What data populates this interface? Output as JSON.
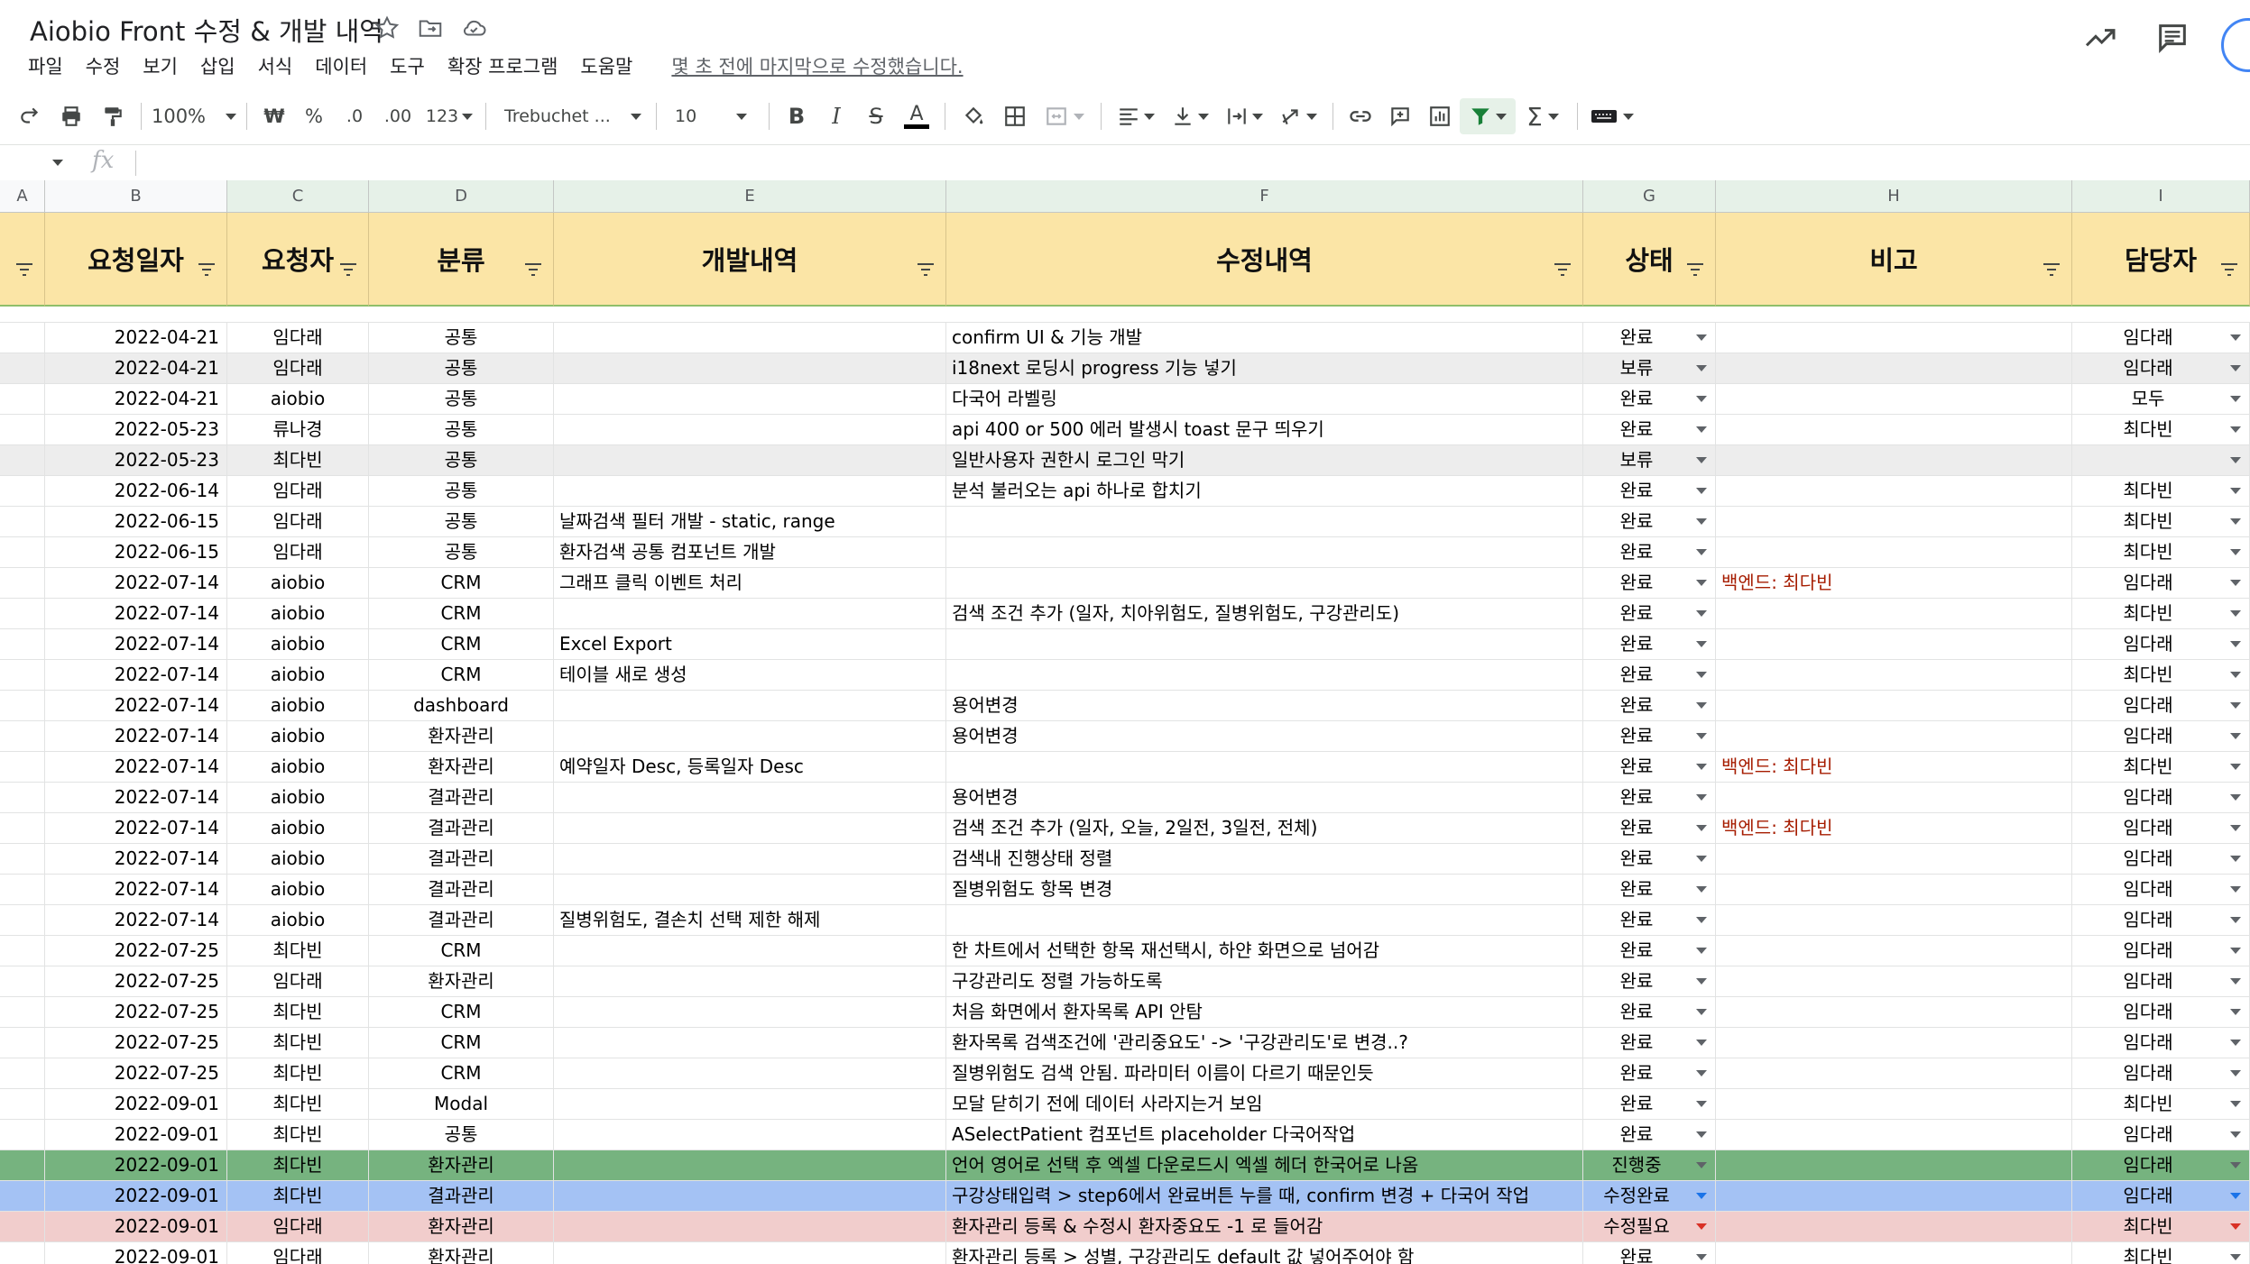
{
  "window": {
    "title": "Aiobio Front 수정 & 개발 내역",
    "menu": [
      "파일",
      "수정",
      "보기",
      "삽입",
      "서식",
      "데이터",
      "도구",
      "확장 프로그램",
      "도움말"
    ],
    "last_edit": "몇 초 전에 마지막으로 수정했습니다."
  },
  "toolbar": {
    "zoom": "100%",
    "currency": "₩",
    "percent": "%",
    "decimal_decrease": ".0",
    "decimal_increase": ".00",
    "number_format": "123",
    "font": "Trebuchet ...",
    "font_size": "10"
  },
  "formula_bar": {
    "fx": "fx",
    "value": ""
  },
  "sheet": {
    "column_letters": [
      "A",
      "B",
      "C",
      "D",
      "E",
      "F",
      "G",
      "H",
      "I"
    ],
    "header_row": [
      "",
      "요청일자",
      "요청자",
      "분류",
      "개발내역",
      "수정내역",
      "상태",
      "비고",
      "담당자"
    ],
    "rows": [
      {
        "date": "2022-04-21",
        "req": "임다래",
        "cat": "공통",
        "dev": "",
        "fix": "confirm UI & 기능 개발",
        "status": "완료",
        "note": "",
        "owner": "임다래",
        "style": "normal"
      },
      {
        "date": "2022-04-21",
        "req": "임다래",
        "cat": "공통",
        "dev": "",
        "fix": "i18next 로딩시 progress 기능 넣기",
        "status": "보류",
        "note": "",
        "owner": "임다래",
        "style": "gray"
      },
      {
        "date": "2022-04-21",
        "req": "aiobio",
        "cat": "공통",
        "dev": "",
        "fix": "다국어 라벨링",
        "status": "완료",
        "note": "",
        "owner": "모두",
        "style": "normal"
      },
      {
        "date": "2022-05-23",
        "req": "류나경",
        "cat": "공통",
        "dev": "",
        "fix": "api 400 or 500 에러 발생시 toast 문구 띄우기",
        "status": "완료",
        "note": "",
        "owner": "최다빈",
        "style": "normal"
      },
      {
        "date": "2022-05-23",
        "req": "최다빈",
        "cat": "공통",
        "dev": "",
        "fix": "일반사용자 권한시 로그인 막기",
        "status": "보류",
        "note": "",
        "owner": "",
        "style": "gray"
      },
      {
        "date": "2022-06-14",
        "req": "임다래",
        "cat": "공통",
        "dev": "",
        "fix": "분석 불러오는 api 하나로 합치기",
        "status": "완료",
        "note": "",
        "owner": "최다빈",
        "style": "normal"
      },
      {
        "date": "2022-06-15",
        "req": "임다래",
        "cat": "공통",
        "dev": "날짜검색 필터 개발 - static, range",
        "fix": "",
        "status": "완료",
        "note": "",
        "owner": "최다빈",
        "style": "normal"
      },
      {
        "date": "2022-06-15",
        "req": "임다래",
        "cat": "공통",
        "dev": "환자검색 공통 컴포넌트 개발",
        "fix": "",
        "status": "완료",
        "note": "",
        "owner": "최다빈",
        "style": "normal"
      },
      {
        "date": "2022-07-14",
        "req": "aiobio",
        "cat": "CRM",
        "dev": "그래프 클릭 이벤트 처리",
        "fix": "",
        "status": "완료",
        "note": "백엔드: 최다빈",
        "owner": "임다래",
        "style": "normal"
      },
      {
        "date": "2022-07-14",
        "req": "aiobio",
        "cat": "CRM",
        "dev": "",
        "fix": "검색 조건 추가 (일자, 치아위험도, 질병위험도, 구강관리도)",
        "status": "완료",
        "note": "",
        "owner": "최다빈",
        "style": "normal"
      },
      {
        "date": "2022-07-14",
        "req": "aiobio",
        "cat": "CRM",
        "dev": "Excel Export",
        "fix": "",
        "status": "완료",
        "note": "",
        "owner": "임다래",
        "style": "normal"
      },
      {
        "date": "2022-07-14",
        "req": "aiobio",
        "cat": "CRM",
        "dev": "테이블 새로 생성",
        "fix": "",
        "status": "완료",
        "note": "",
        "owner": "최다빈",
        "style": "normal"
      },
      {
        "date": "2022-07-14",
        "req": "aiobio",
        "cat": "dashboard",
        "dev": "",
        "fix": "용어변경",
        "status": "완료",
        "note": "",
        "owner": "임다래",
        "style": "normal"
      },
      {
        "date": "2022-07-14",
        "req": "aiobio",
        "cat": "환자관리",
        "dev": "",
        "fix": "용어변경",
        "status": "완료",
        "note": "",
        "owner": "임다래",
        "style": "normal"
      },
      {
        "date": "2022-07-14",
        "req": "aiobio",
        "cat": "환자관리",
        "dev": "예약일자 Desc, 등록일자 Desc",
        "fix": "",
        "status": "완료",
        "note": "백엔드: 최다빈",
        "owner": "최다빈",
        "style": "normal"
      },
      {
        "date": "2022-07-14",
        "req": "aiobio",
        "cat": "결과관리",
        "dev": "",
        "fix": "용어변경",
        "status": "완료",
        "note": "",
        "owner": "임다래",
        "style": "normal"
      },
      {
        "date": "2022-07-14",
        "req": "aiobio",
        "cat": "결과관리",
        "dev": "",
        "fix": "검색 조건 추가 (일자, 오늘, 2일전, 3일전, 전체)",
        "status": "완료",
        "note": "백엔드: 최다빈",
        "owner": "임다래",
        "style": "normal"
      },
      {
        "date": "2022-07-14",
        "req": "aiobio",
        "cat": "결과관리",
        "dev": "",
        "fix": "검색내 진행상태 정렬",
        "status": "완료",
        "note": "",
        "owner": "임다래",
        "style": "normal"
      },
      {
        "date": "2022-07-14",
        "req": "aiobio",
        "cat": "결과관리",
        "dev": "",
        "fix": "질병위험도 항목 변경",
        "status": "완료",
        "note": "",
        "owner": "임다래",
        "style": "normal"
      },
      {
        "date": "2022-07-14",
        "req": "aiobio",
        "cat": "결과관리",
        "dev": "질병위험도, 결손치 선택 제한 해제",
        "fix": "",
        "status": "완료",
        "note": "",
        "owner": "임다래",
        "style": "normal"
      },
      {
        "date": "2022-07-25",
        "req": "최다빈",
        "cat": "CRM",
        "dev": "",
        "fix": "한 차트에서 선택한 항목 재선택시, 하얀 화면으로 넘어감",
        "status": "완료",
        "note": "",
        "owner": "임다래",
        "style": "normal"
      },
      {
        "date": "2022-07-25",
        "req": "임다래",
        "cat": "환자관리",
        "dev": "",
        "fix": "구강관리도 정렬 가능하도록",
        "status": "완료",
        "note": "",
        "owner": "임다래",
        "style": "normal"
      },
      {
        "date": "2022-07-25",
        "req": "최다빈",
        "cat": "CRM",
        "dev": "",
        "fix": "처음 화면에서 환자목록 API 안탐",
        "status": "완료",
        "note": "",
        "owner": "임다래",
        "style": "normal"
      },
      {
        "date": "2022-07-25",
        "req": "최다빈",
        "cat": "CRM",
        "dev": "",
        "fix": "환자목록 검색조건에 '관리중요도' -> '구강관리도'로 변경..?",
        "status": "완료",
        "note": "",
        "owner": "임다래",
        "style": "normal"
      },
      {
        "date": "2022-07-25",
        "req": "최다빈",
        "cat": "CRM",
        "dev": "",
        "fix": "질병위험도 검색 안됨. 파라미터 이름이 다르기 때문인듯",
        "status": "완료",
        "note": "",
        "owner": "임다래",
        "style": "normal"
      },
      {
        "date": "2022-09-01",
        "req": "최다빈",
        "cat": "Modal",
        "dev": "",
        "fix": "모달 닫히기 전에 데이터 사라지는거 보임",
        "status": "완료",
        "note": "",
        "owner": "최다빈",
        "style": "normal"
      },
      {
        "date": "2022-09-01",
        "req": "최다빈",
        "cat": "공통",
        "dev": "",
        "fix": "ASelectPatient 컴포넌트 placeholder 다국어작업",
        "status": "완료",
        "note": "",
        "owner": "임다래",
        "style": "normal"
      },
      {
        "date": "2022-09-01",
        "req": "최다빈",
        "cat": "환자관리",
        "dev": "",
        "fix": "언어 영어로 선택 후 엑셀 다운로드시 엑셀 헤더 한국어로 나옴",
        "status": "진행중",
        "note": "",
        "owner": "임다래",
        "style": "green"
      },
      {
        "date": "2022-09-01",
        "req": "최다빈",
        "cat": "결과관리",
        "dev": "",
        "fix": "구강상태입력 > step6에서 완료버튼 누를 때, confirm 변경 + 다국어 작업",
        "status": "수정완료",
        "note": "",
        "owner": "임다래",
        "style": "blue"
      },
      {
        "date": "2022-09-01",
        "req": "임다래",
        "cat": "환자관리",
        "dev": "",
        "fix": "환자관리 등록 & 수정시 환자중요도 -1 로 들어감",
        "status": "수정필요",
        "note": "",
        "owner": "최다빈",
        "style": "red"
      },
      {
        "date": "2022-09-01",
        "req": "임다래",
        "cat": "환자관리",
        "dev": "",
        "fix": "환자관리 등록 > 성별, 구강관리도 default 값 넣어주어야 함",
        "status": "완료",
        "note": "",
        "owner": "최다빈",
        "style": "normal"
      }
    ]
  },
  "colors": {
    "header_fill": "#fbe5a6",
    "gray_row": "#ededed",
    "green_row": "#76b37f",
    "blue_row": "#a4c2f4",
    "red_row": "#f1cdcc",
    "note_text": "#a61c00"
  }
}
